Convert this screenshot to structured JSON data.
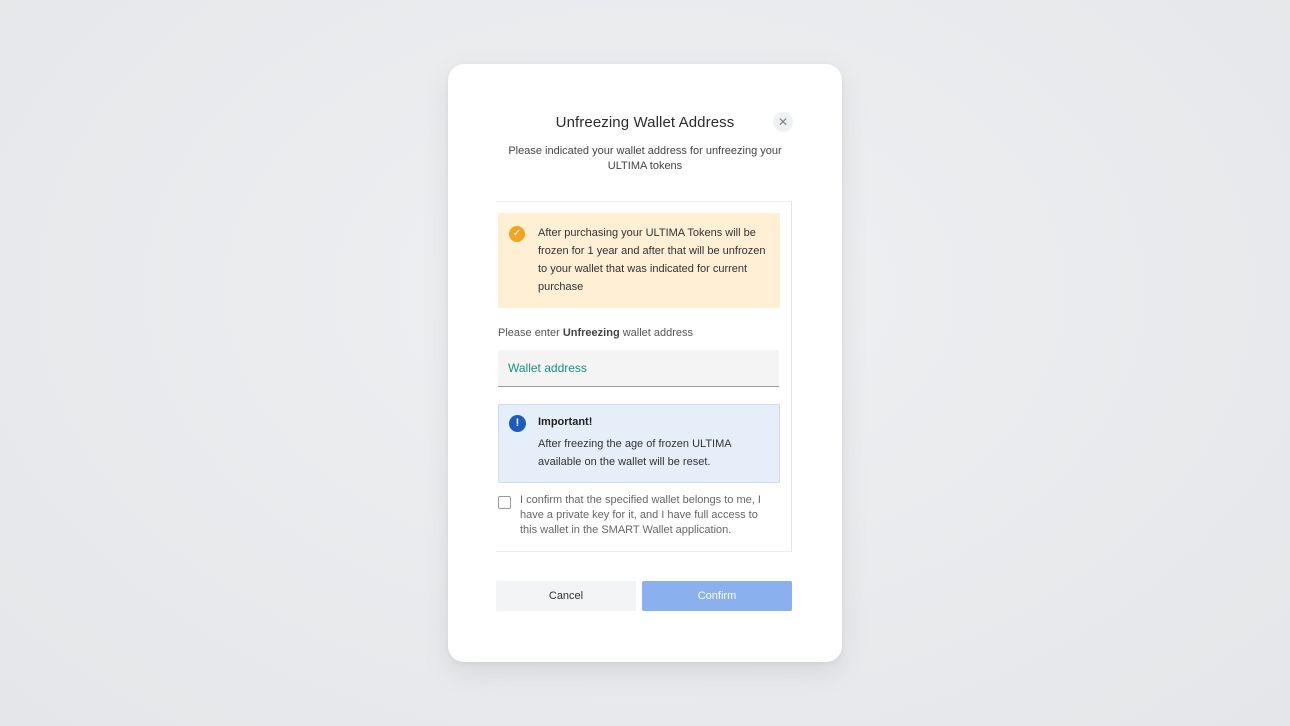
{
  "dialog": {
    "title": "Unfreezing Wallet Address",
    "close_icon": "close-icon",
    "subtitle": "Please indicated your wallet address for unfreezing your ULTIMA tokens"
  },
  "warning": {
    "icon": "check-circle-icon",
    "text": "After purchasing your ULTIMA Tokens will be frozen for 1 year and after that will be unfrozen to your wallet that was indicated for current purchase",
    "color": "#ffefd5"
  },
  "wallet_field": {
    "label_prefix": "Please enter",
    "label_bold": "Unfreezing",
    "label_suffix": "wallet address",
    "placeholder": "Wallet address",
    "value": ""
  },
  "important": {
    "icon": "exclamation-circle-icon",
    "title": "Important!",
    "text": "After freezing the age of frozen ULTIMA available on the wallet will be reset.",
    "color": "#e6eef9"
  },
  "confirmation": {
    "checked": false,
    "text": "I confirm that the specified wallet belongs to me, I have a private key for it, and I have full access to this wallet in the SMART Wallet application."
  },
  "buttons": {
    "cancel": "Cancel",
    "confirm": "Confirm",
    "confirm_color": "#8ab0ee"
  }
}
